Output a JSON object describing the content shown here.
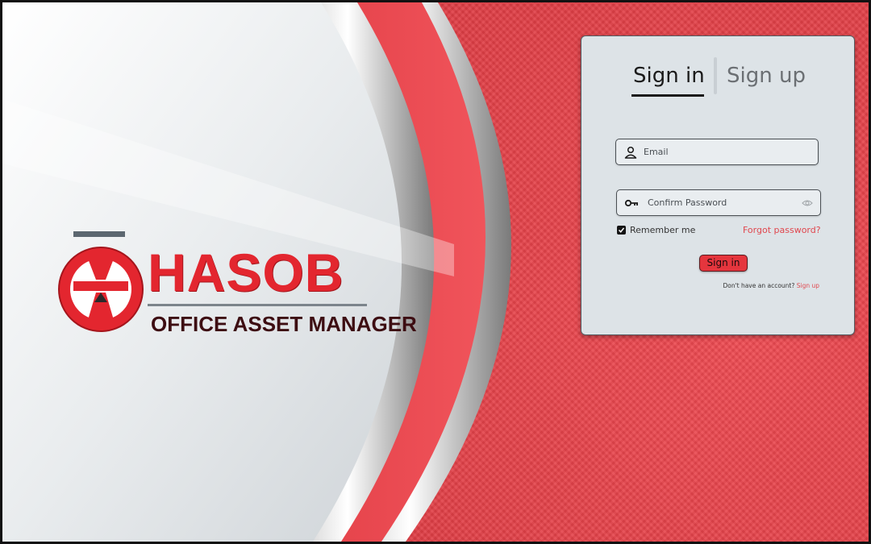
{
  "brand": {
    "name": "HASOB",
    "subtitle": "OFFICE ASSET MANAGER"
  },
  "auth": {
    "tabs": [
      {
        "label": "Sign in",
        "active": true
      },
      {
        "label": "Sign up",
        "active": false
      }
    ],
    "email": {
      "placeholder": "Email",
      "icon": "user-icon"
    },
    "password": {
      "placeholder": "Confirm Password",
      "icon": "key-icon",
      "toggle_icon": "eye-icon"
    },
    "remember": {
      "label": "Remember me",
      "checked": true
    },
    "forgot_label": "Forgot password?",
    "submit_label": "Sign in",
    "footer_text": "Don't have an account?",
    "footer_link": "Sign up"
  },
  "colors": {
    "accent": "#e5353d",
    "background_red": "#dc3a42",
    "card": "#dde3e7",
    "link": "#e0474e"
  }
}
